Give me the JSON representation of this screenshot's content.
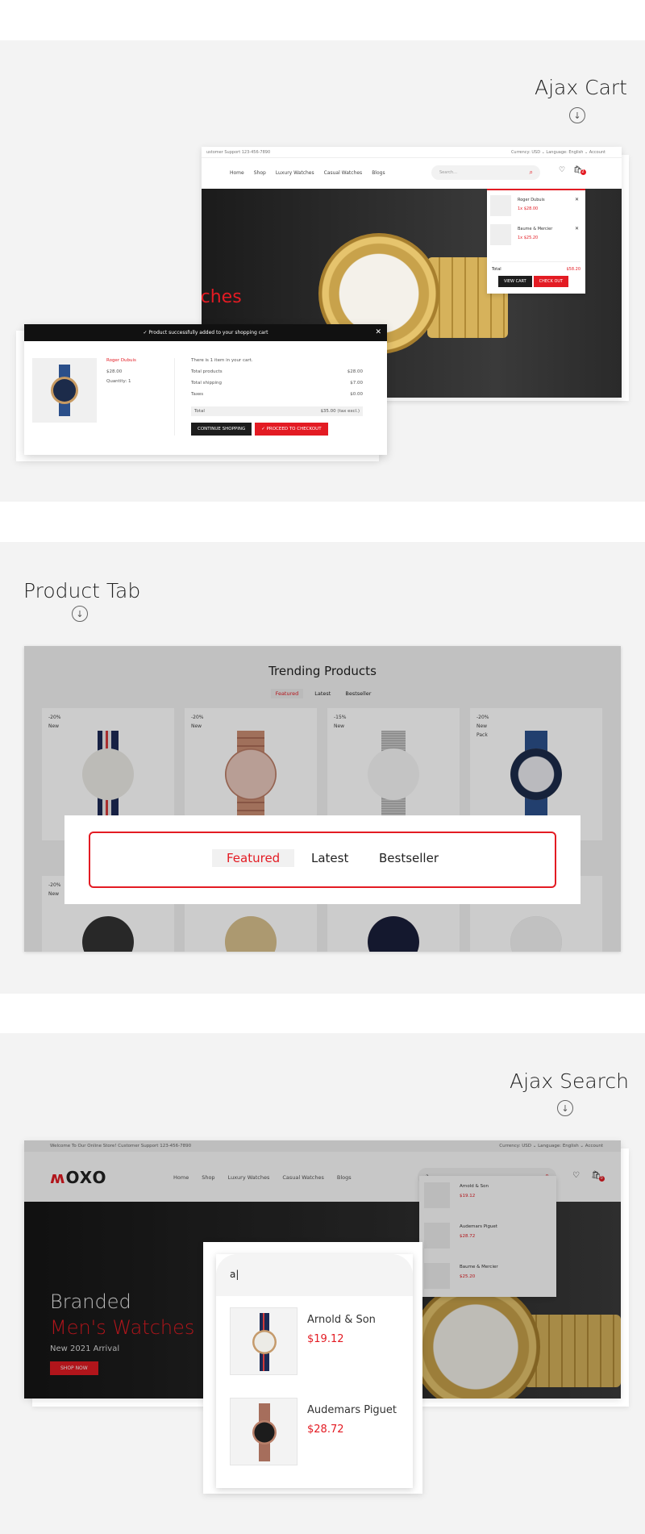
{
  "sections": {
    "ajax_cart": {
      "title": "Ajax Cart"
    },
    "product_tab": {
      "title": "Product Tab"
    },
    "ajax_search": {
      "title": "Ajax Search"
    }
  },
  "cart_shot": {
    "topbar_left": "ustomer Support 123-456-7890",
    "topbar_right": "Currency: USD ⌄     Language: English ⌄     Account",
    "nav": [
      "Home",
      "Shop",
      "Luxury Watches",
      "Casual Watches",
      "Blogs"
    ],
    "search_placeholder": "Search...",
    "cart_count": "2",
    "hero_fragment": "tches",
    "minicart": {
      "items": [
        {
          "name": "Roger Dubuis",
          "price": "1x $28.00"
        },
        {
          "name": "Baume & Mercier",
          "price": "1x $25.20"
        }
      ],
      "total_label": "Total",
      "total_value": "$58.20",
      "view_cart": "VIEW CART",
      "checkout": "CHECK OUT"
    },
    "modal": {
      "header": "Product successfully added to your shopping cart",
      "product_name": "Roger Dubuis",
      "product_price": "$28.00",
      "quantity": "Quantity: 1",
      "summary": "There is 1 item in your cart.",
      "rows": [
        {
          "label": "Total products",
          "value": "$28.00"
        },
        {
          "label": "Total shipping",
          "value": "$7.00"
        },
        {
          "label": "Taxes",
          "value": "$0.00"
        }
      ],
      "total_label": "Total",
      "total_value": "$35.00 (tax excl.)",
      "continue": "CONTINUE SHOPPING",
      "proceed": "PROCEED TO CHECKOUT"
    }
  },
  "tab_shot": {
    "title": "Trending Products",
    "tabs": [
      "Featured",
      "Latest",
      "Bestseller"
    ],
    "cards": [
      {
        "badge": "-20%",
        "tag": "New",
        "tag2": ""
      },
      {
        "badge": "-20%",
        "tag": "New",
        "tag2": ""
      },
      {
        "badge": "-15%",
        "tag": "New",
        "tag2": ""
      },
      {
        "badge": "-20%",
        "tag": "New",
        "tag2": "Pack"
      },
      {
        "badge": "-20%",
        "tag": "New",
        "tag2": ""
      }
    ],
    "zoom_tabs": [
      "Featured",
      "Latest",
      "Bestseller"
    ]
  },
  "search_shot": {
    "topbar_left": "Welcome To Our Online Store!     Customer Support 123-456-7890",
    "topbar_right": "Currency: USD ⌄     Language: English ⌄     Account",
    "logo": "OXO",
    "nav": [
      "Home",
      "Shop",
      "Luxury Watches",
      "Casual Watches",
      "Blogs"
    ],
    "query": "a",
    "cart_count": "0",
    "results": [
      {
        "name": "Arnold & Son",
        "price": "$19.12"
      },
      {
        "name": "Audemars Piguet",
        "price": "$28.72"
      },
      {
        "name": "Baume & Mercier",
        "price": "$25.20"
      }
    ],
    "hero_line1": "Branded",
    "hero_line2": "Men's Watches",
    "hero_line3": "New 2021 Arrival",
    "hero_button": "SHOP NOW",
    "zoom_query": "a|",
    "zoom_results": [
      {
        "name": "Arnold & Son",
        "price": "$19.12"
      },
      {
        "name": "Audemars Piguet",
        "price": "$28.72"
      }
    ]
  },
  "colors": {
    "accent": "#e31b23",
    "dark": "#111111",
    "band": "#f3f3f3"
  }
}
